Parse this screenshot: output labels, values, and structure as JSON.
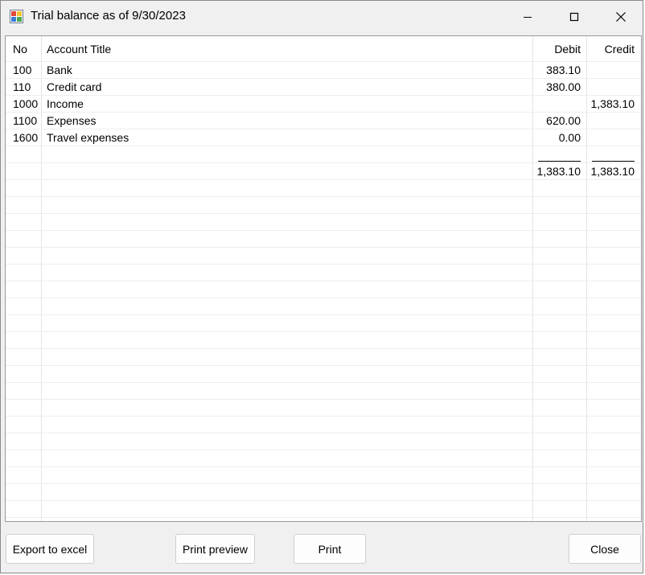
{
  "window": {
    "title": "Trial balance as of 9/30/2023",
    "controls": {
      "minimize": "minimize",
      "maximize": "maximize",
      "close": "close"
    }
  },
  "grid": {
    "columns": {
      "no": "No",
      "title": "Account Title",
      "debit": "Debit",
      "credit": "Credit"
    },
    "rows": [
      {
        "no": "100",
        "title": "Bank",
        "debit": "383.10",
        "credit": ""
      },
      {
        "no": "110",
        "title": "Credit card",
        "debit": "380.00",
        "credit": ""
      },
      {
        "no": "1000",
        "title": "Income",
        "debit": "",
        "credit": "1,383.10"
      },
      {
        "no": "1100",
        "title": "Expenses",
        "debit": "620.00",
        "credit": ""
      },
      {
        "no": "1600",
        "title": "Travel expenses",
        "debit": "0.00",
        "credit": ""
      }
    ],
    "totals": {
      "debit": "1,383.10",
      "credit": "1,383.10"
    }
  },
  "buttons": {
    "export": "Export to excel",
    "preview": "Print preview",
    "print": "Print",
    "close": "Close"
  },
  "icons": {
    "app": "spreadsheet-app-icon",
    "minimize": "minimize-icon",
    "maximize": "maximize-icon",
    "close": "close-icon"
  }
}
